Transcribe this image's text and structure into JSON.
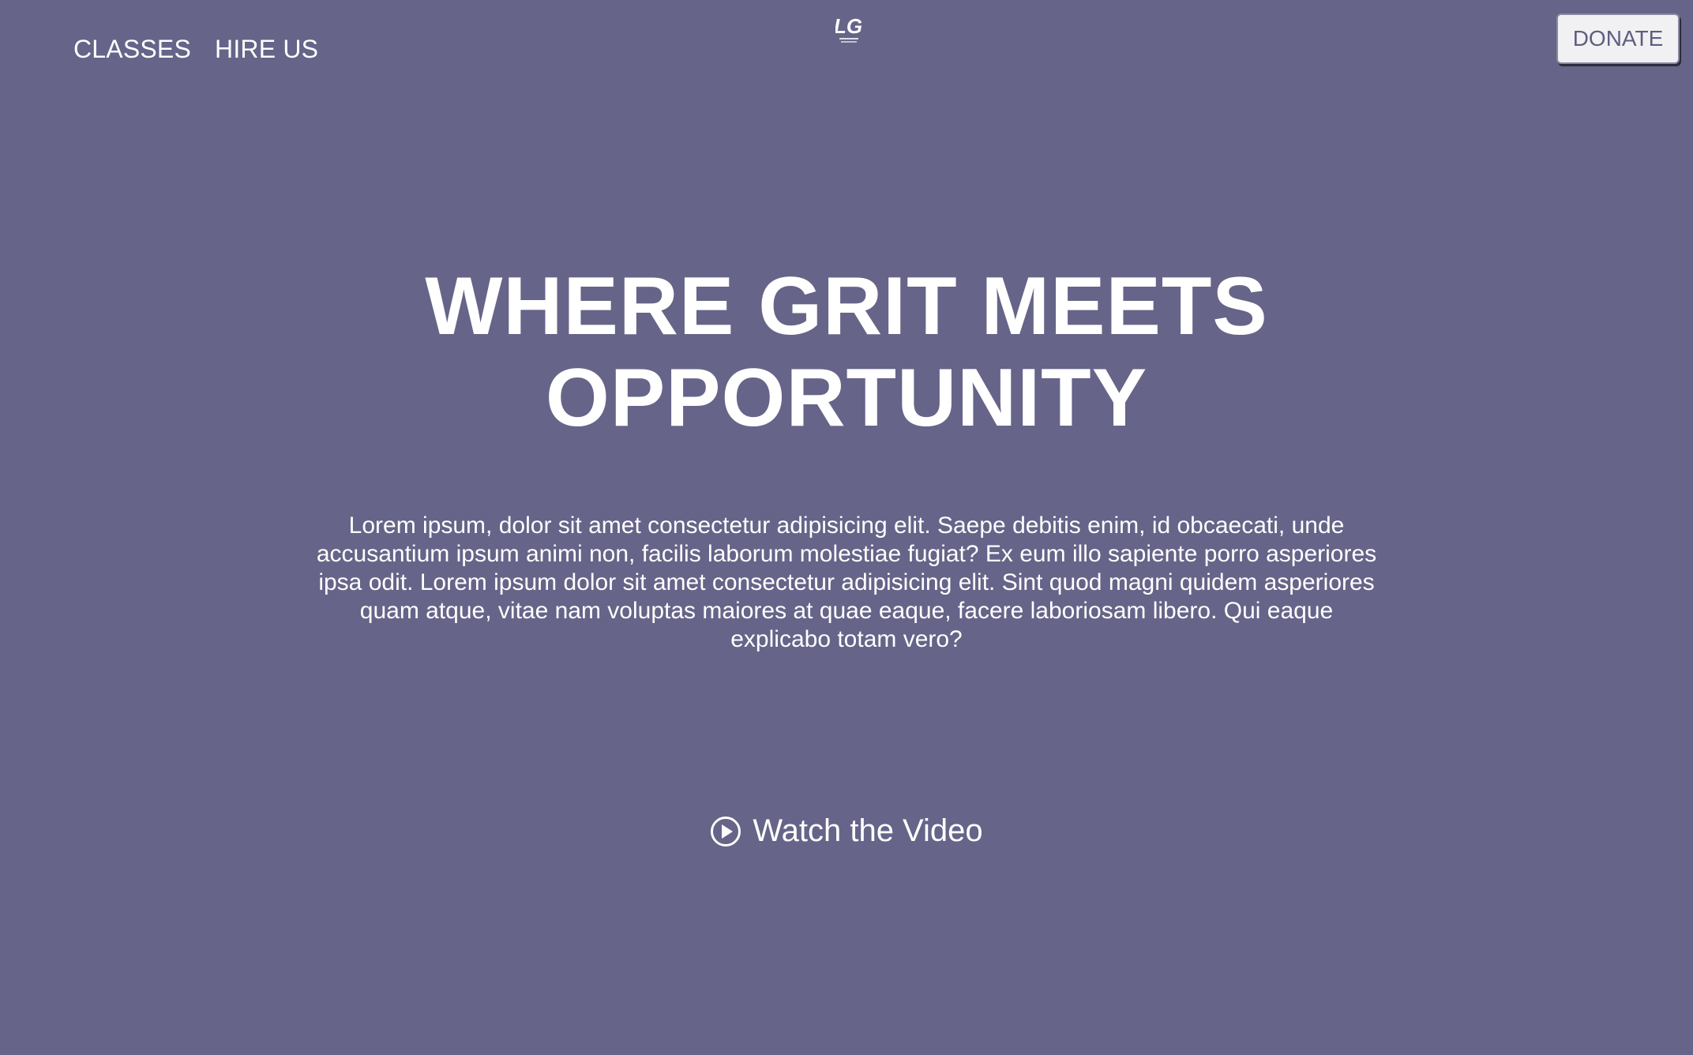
{
  "nav": {
    "items": [
      {
        "label": "CLASSES"
      },
      {
        "label": "HIRE US"
      }
    ]
  },
  "logo": {
    "text": "LG",
    "icon": "brand-logo-icon"
  },
  "donate": {
    "label": "DONATE"
  },
  "hero": {
    "title_line1": "WHERE GRIT MEETS",
    "title_line2": "OPPORTUNITY",
    "body": "Lorem ipsum, dolor sit amet consectetur adipisicing elit. Saepe debitis enim, id obcaecati, unde accusantium ipsum animi non, facilis laborum molestiae fugiat? Ex eum illo sapiente porro asperiores ipsa odit. Lorem ipsum dolor sit amet consectetur adipisicing elit. Sint quod magni quidem asperiores quam atque, vitae nam voluptas maiores at quae eaque, facere laboriosam libero. Qui eaque explicabo totam vero?",
    "video_label": "Watch the Video",
    "video_icon": "play-circle-icon"
  },
  "colors": {
    "background": "#666488",
    "text": "#ffffff",
    "button_bg": "#f1f1f3",
    "button_text": "#5f5d80"
  }
}
